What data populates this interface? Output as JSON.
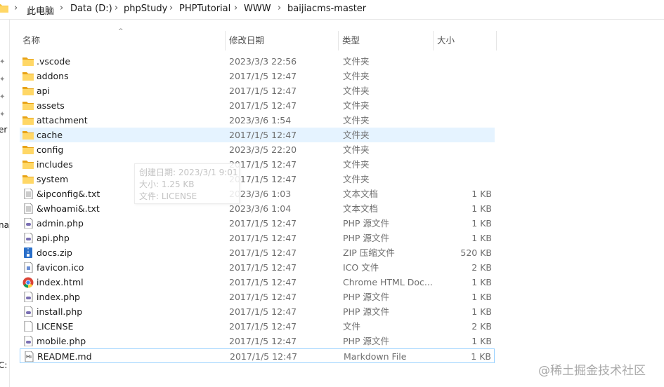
{
  "breadcrumb": [
    "此电脑",
    "Data (D:)",
    "phpStudy",
    "PHPTutorial",
    "WWW",
    "baijiacms-master"
  ],
  "nav": {
    "partial_labels": [
      "er",
      "na",
      "C:"
    ]
  },
  "columns": {
    "name": "名称",
    "date": "修改日期",
    "type": "类型",
    "size": "大小"
  },
  "files": [
    {
      "name": ".vscode",
      "date": "2023/3/3 22:56",
      "type": "文件夹",
      "size": "",
      "icon": "folder-icon"
    },
    {
      "name": "addons",
      "date": "2017/1/5 12:47",
      "type": "文件夹",
      "size": "",
      "icon": "folder-icon"
    },
    {
      "name": "api",
      "date": "2017/1/5 12:47",
      "type": "文件夹",
      "size": "",
      "icon": "folder-icon"
    },
    {
      "name": "assets",
      "date": "2017/1/5 12:47",
      "type": "文件夹",
      "size": "",
      "icon": "folder-icon"
    },
    {
      "name": "attachment",
      "date": "2023/3/6 1:54",
      "type": "文件夹",
      "size": "",
      "icon": "folder-icon"
    },
    {
      "name": "cache",
      "date": "2017/1/5 12:47",
      "type": "文件夹",
      "size": "",
      "icon": "folder-icon"
    },
    {
      "name": "config",
      "date": "2023/3/5 22:20",
      "type": "文件夹",
      "size": "",
      "icon": "folder-icon"
    },
    {
      "name": "includes",
      "date": "2017/1/5 12:47",
      "type": "文件夹",
      "size": "",
      "icon": "folder-icon"
    },
    {
      "name": "system",
      "date": "2017/1/5 12:47",
      "type": "文件夹",
      "size": "",
      "icon": "folder-icon"
    },
    {
      "name": "&ipconfig&.txt",
      "date": "2023/3/6 1:03",
      "type": "文本文档",
      "size": "1 KB",
      "icon": "text-file-icon"
    },
    {
      "name": "&whoami&.txt",
      "date": "2023/3/6 1:04",
      "type": "文本文档",
      "size": "1 KB",
      "icon": "text-file-icon"
    },
    {
      "name": "admin.php",
      "date": "2017/1/5 12:47",
      "type": "PHP 源文件",
      "size": "1 KB",
      "icon": "php-file-icon"
    },
    {
      "name": "api.php",
      "date": "2017/1/5 12:47",
      "type": "PHP 源文件",
      "size": "1 KB",
      "icon": "php-file-icon"
    },
    {
      "name": "docs.zip",
      "date": "2017/1/5 12:47",
      "type": "ZIP 压缩文件",
      "size": "520 KB",
      "icon": "zip-file-icon"
    },
    {
      "name": "favicon.ico",
      "date": "2017/1/5 12:47",
      "type": "ICO 文件",
      "size": "2 KB",
      "icon": "ico-file-icon"
    },
    {
      "name": "index.html",
      "date": "2017/1/5 12:47",
      "type": "Chrome HTML Doc...",
      "size": "1 KB",
      "icon": "chrome-icon"
    },
    {
      "name": "index.php",
      "date": "2017/1/5 12:47",
      "type": "PHP 源文件",
      "size": "1 KB",
      "icon": "php-file-icon"
    },
    {
      "name": "install.php",
      "date": "2017/1/5 12:47",
      "type": "PHP 源文件",
      "size": "1 KB",
      "icon": "php-file-icon"
    },
    {
      "name": "LICENSE",
      "date": "2017/1/5 12:47",
      "type": "文件",
      "size": "2 KB",
      "icon": "blank-file-icon"
    },
    {
      "name": "mobile.php",
      "date": "2017/1/5 12:47",
      "type": "PHP 源文件",
      "size": "1 KB",
      "icon": "php-file-icon"
    },
    {
      "name": "README.md",
      "date": "2017/1/5 12:47",
      "type": "Markdown File",
      "size": "1 KB",
      "icon": "markdown-file-icon"
    }
  ],
  "hovered_row": 5,
  "focused_row": 20,
  "tooltip": {
    "created": "创建日期: 2023/3/1 9:01",
    "size": "大小: 1.25 KB",
    "files": "文件: LICENSE"
  },
  "watermark": "@稀土掘金技术社区",
  "colors": {
    "folder": "#f5c542",
    "hover_bg": "#e5f3ff",
    "focus_border": "#99d1ff"
  }
}
